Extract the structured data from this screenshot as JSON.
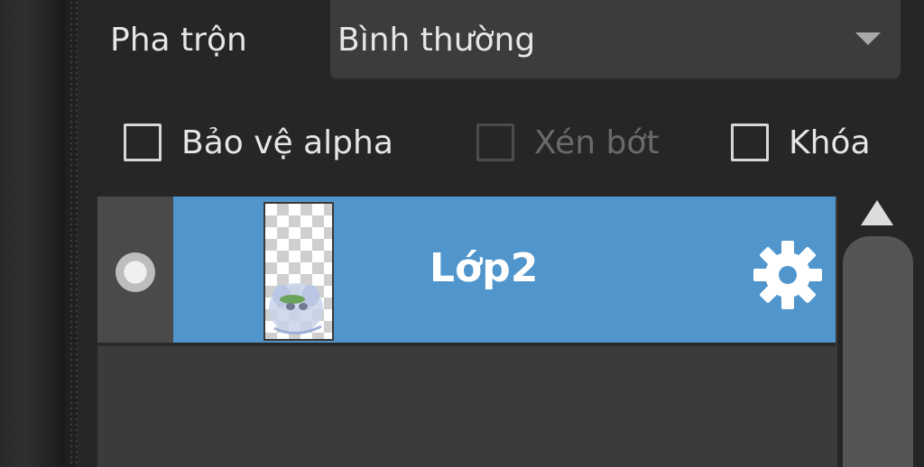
{
  "blend": {
    "label": "Pha trộn",
    "value": "Bình thường"
  },
  "options": [
    {
      "label": "Bảo vệ alpha",
      "checked": false,
      "enabled": true
    },
    {
      "label": "Xén bớt",
      "checked": false,
      "enabled": false
    },
    {
      "label": "Khóa",
      "checked": false,
      "enabled": true
    }
  ],
  "layers": [
    {
      "name": "Lớp2",
      "visible": true,
      "selected": true
    }
  ],
  "colors": {
    "selected_row": "#5096cc",
    "panel_bg": "#262626"
  },
  "icons": {
    "visibility": "visibility-dot-icon",
    "settings": "gear-icon",
    "dropdown": "chevron-down-icon",
    "scroll_up": "scroll-up-arrow-icon"
  }
}
